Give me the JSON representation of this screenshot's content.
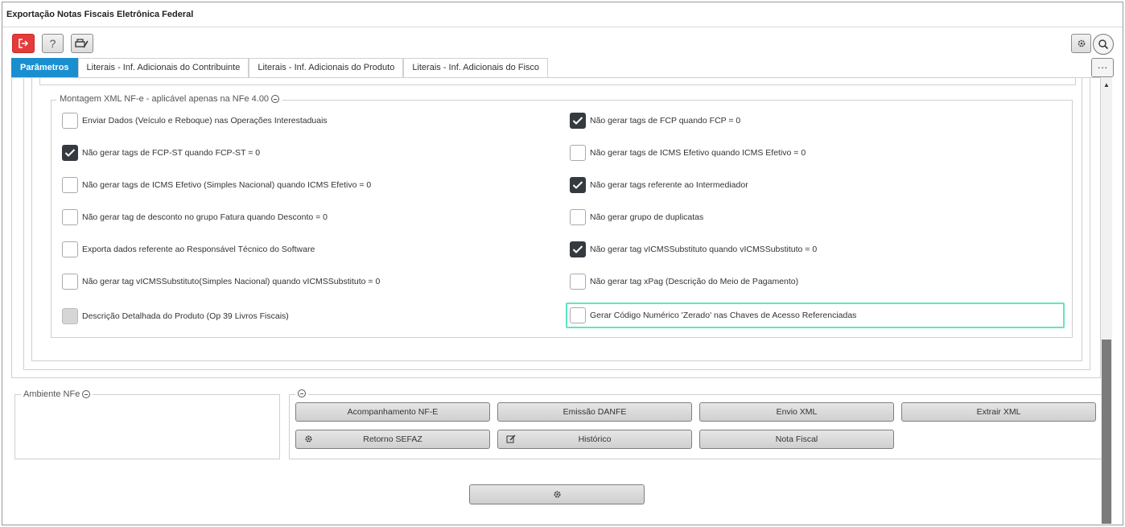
{
  "window": {
    "title": "Exportação Notas Fiscais Eletrônica Federal"
  },
  "toolbar": {
    "exit_icon": "exit-icon",
    "help_label": "?",
    "print_icon": "printer-settings-icon",
    "settings_icon": "gear-icon",
    "search_icon": "search-icon",
    "more_label": "···"
  },
  "tabs": [
    {
      "label": "Parâmetros",
      "active": true
    },
    {
      "label": "Literais - Inf. Adicionais do Contribuinte"
    },
    {
      "label": "Literais - Inf. Adicionais do Produto"
    },
    {
      "label": "Literais - Inf. Adicionais do Fisco"
    }
  ],
  "xml_section": {
    "legend": "Montagem XML NF-e - aplicável apenas na NFe 4.00",
    "left_options": [
      {
        "label": "Enviar Dados (Veículo e Reboque) nas Operações Interestaduais",
        "checked": false
      },
      {
        "label": "Não gerar tags de FCP-ST quando FCP-ST = 0",
        "checked": true
      },
      {
        "label": "Não gerar tags de ICMS Efetivo (Simples Nacional) quando ICMS Efetivo = 0",
        "checked": false
      },
      {
        "label": "Não gerar tag de desconto no grupo Fatura quando Desconto = 0",
        "checked": false
      },
      {
        "label": "Exporta dados referente ao Responsável Técnico do Software",
        "checked": false
      },
      {
        "label": "Não gerar tag vICMSSubstituto(Simples Nacional) quando vICMSSubstituto = 0",
        "checked": false
      },
      {
        "label": "Descrição Detalhada do Produto (Op 39 Livros Fiscais)",
        "checked": false,
        "disabled": true
      }
    ],
    "right_options": [
      {
        "label": "Não gerar tags de FCP quando FCP = 0",
        "checked": true
      },
      {
        "label": "Não gerar tags de ICMS Efetivo quando ICMS Efetivo = 0",
        "checked": false
      },
      {
        "label": "Não gerar tags referente ao Intermediador",
        "checked": true
      },
      {
        "label": "Não gerar grupo de duplicatas",
        "checked": false
      },
      {
        "label": "Não gerar tag vICMSSubstituto quando vICMSSubstituto = 0",
        "checked": true
      },
      {
        "label": "Não gerar tag xPag (Descrição do Meio de Pagamento)",
        "checked": false
      },
      {
        "label": "Gerar Código Numérico 'Zerado' nas Chaves de Acesso Referenciadas",
        "checked": false,
        "focused": true
      }
    ]
  },
  "ambiente": {
    "legend": "Ambiente NFe"
  },
  "actions": {
    "acompanhamento": "Acompanhamento NF-E",
    "emissao": "Emissão DANFE",
    "envio": "Envio XML",
    "extrair": "Extrair XML",
    "retorno": "Retorno SEFAZ",
    "historico": "Histórico",
    "nota": "Nota Fiscal"
  },
  "colors": {
    "accent": "#1a8fcf",
    "exit": "#e53b3b",
    "focus": "#5ee6c2",
    "checked": "#343a40"
  }
}
